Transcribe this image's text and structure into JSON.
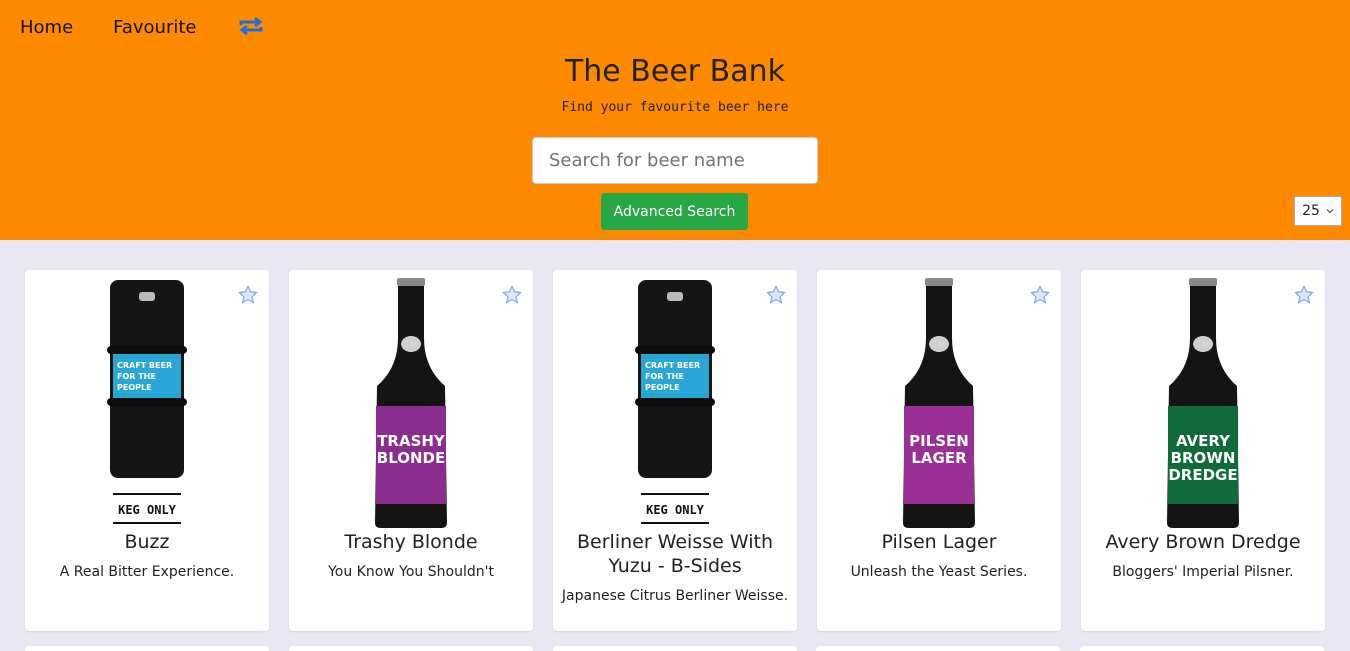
{
  "nav": {
    "home": "Home",
    "favourite": "Favourite",
    "swap_icon": "swap-arrows-icon"
  },
  "header": {
    "title": "The Beer Bank",
    "subtitle": "Find your favourite beer here",
    "search_placeholder": "Search for beer name",
    "advanced_search": "Advanced Search",
    "page_size": "25"
  },
  "colors": {
    "header_bg": "#ff8a00",
    "button_green": "#28a745",
    "page_bg": "#e9e7f1",
    "star": "#8ab4f8"
  },
  "cards": [
    {
      "name": "Buzz",
      "tagline": "A Real Bitter Experience.",
      "bottle": "keg",
      "label_color": "#2aa6d6",
      "label_text": [
        "CRAFT BEER",
        "FOR THE",
        "PEOPLE"
      ],
      "badge": "KEG ONLY"
    },
    {
      "name": "Trashy Blonde",
      "tagline": "You Know You Shouldn't",
      "bottle": "bottle",
      "label_color": "#8b2c8f",
      "label_text": [
        "TRASHY",
        "BLONDE"
      ],
      "badge": ""
    },
    {
      "name": "Berliner Weisse With Yuzu - B-Sides",
      "tagline": "Japanese Citrus Berliner Weisse.",
      "bottle": "keg",
      "label_color": "#2aa6d6",
      "label_text": [
        "CRAFT BEER",
        "FOR THE",
        "PEOPLE"
      ],
      "badge": "KEG ONLY"
    },
    {
      "name": "Pilsen Lager",
      "tagline": "Unleash the Yeast Series.",
      "bottle": "bottle",
      "label_color": "#9a2f95",
      "label_text": [
        "PILSEN",
        "LAGER"
      ],
      "badge": ""
    },
    {
      "name": "Avery Brown Dredge",
      "tagline": "Bloggers' Imperial Pilsner.",
      "bottle": "bottle",
      "label_color": "#0f6b3a",
      "label_text": [
        "AVERY",
        "BROWN",
        "DREDGE"
      ],
      "badge": ""
    }
  ]
}
